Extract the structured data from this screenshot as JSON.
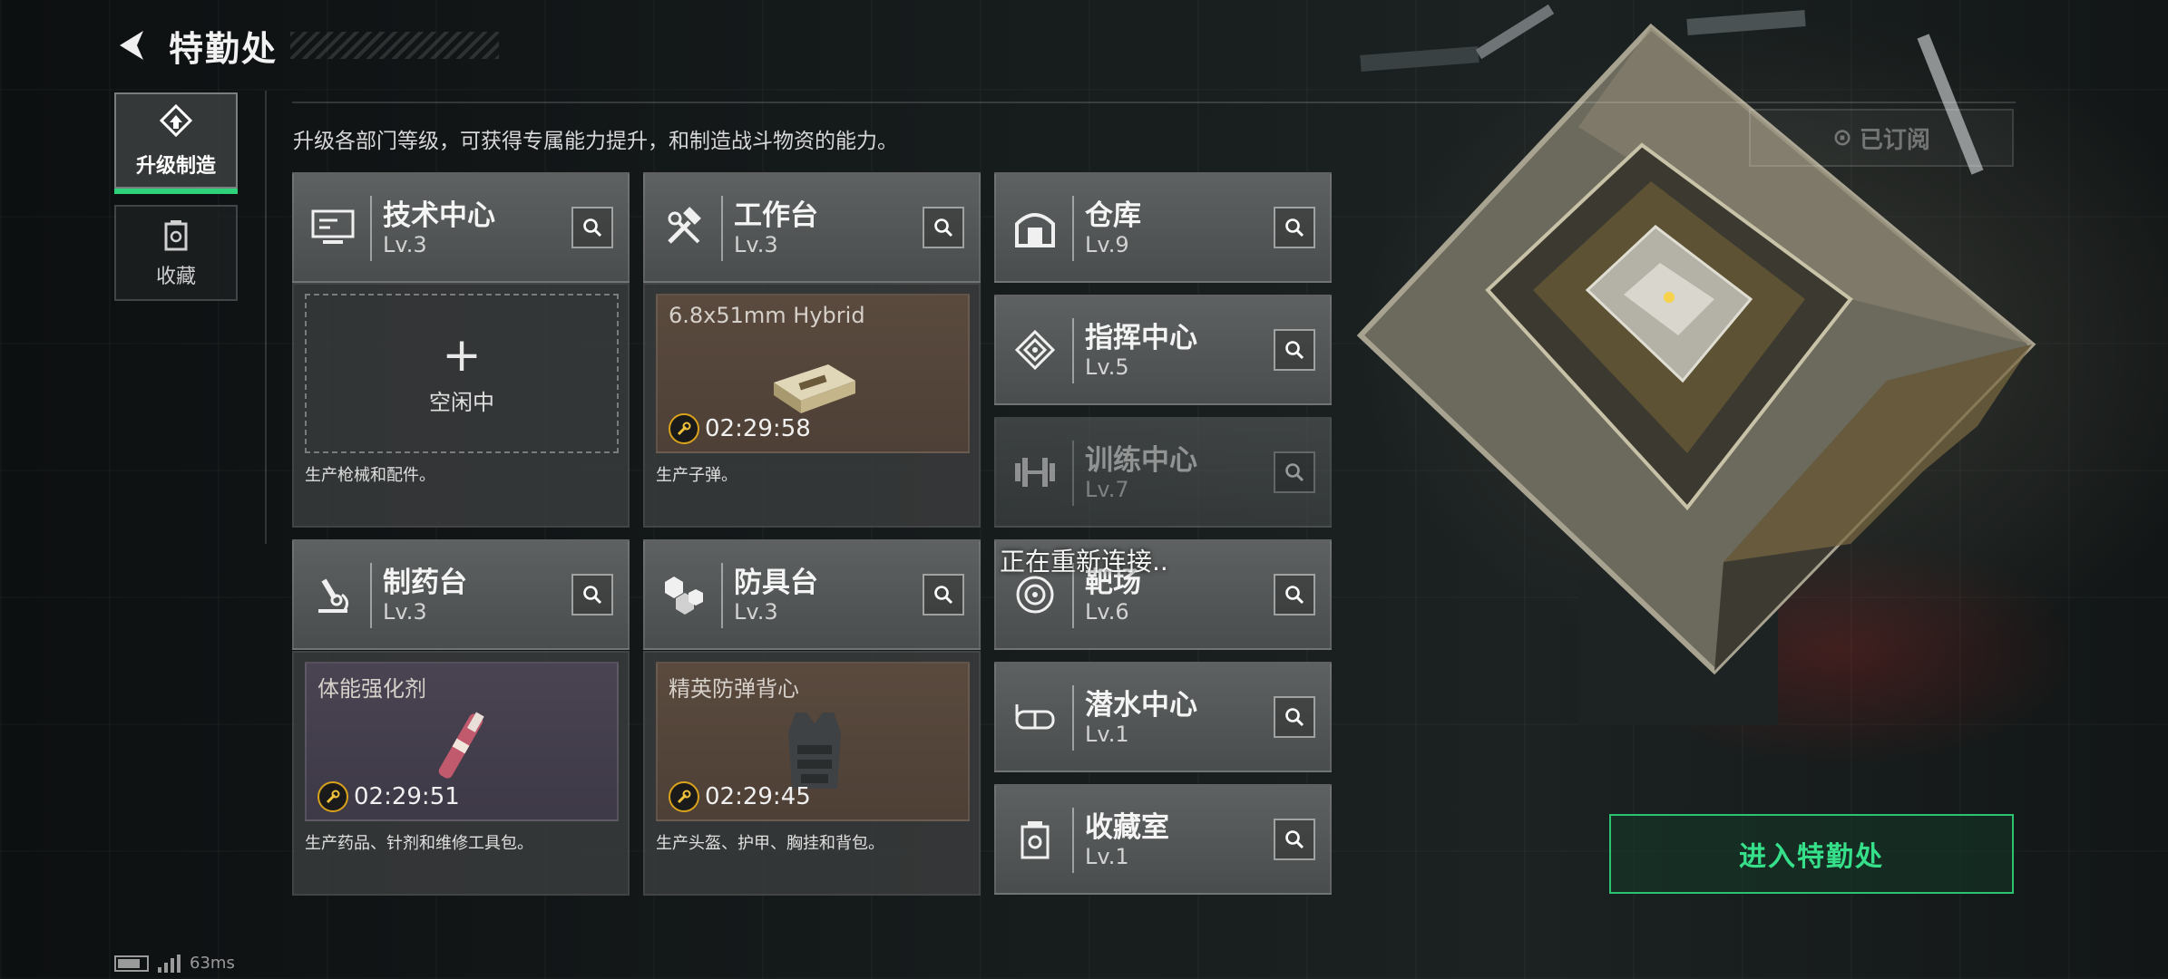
{
  "header": {
    "title": "特勤处"
  },
  "side_tabs": [
    {
      "label": "升级制造",
      "active": true
    },
    {
      "label": "收藏",
      "active": false
    }
  ],
  "description": "升级各部门等级，可获得专属能力提升，和制造战斗物资的能力。",
  "subscribed_label": "已订阅",
  "departments": [
    {
      "name": "技术中心",
      "level": "Lv.3",
      "icon": "computer-icon"
    },
    {
      "name": "工作台",
      "level": "Lv.3",
      "icon": "hammer-wrench-icon"
    },
    {
      "name": "仓库",
      "level": "Lv.9",
      "icon": "warehouse-icon"
    },
    {
      "name": "指挥中心",
      "level": "Lv.5",
      "icon": "command-chip-icon"
    },
    {
      "name": "训练中心",
      "level": "Lv.7",
      "icon": "dumbbell-icon"
    },
    {
      "name": "制药台",
      "level": "Lv.3",
      "icon": "microscope-icon"
    },
    {
      "name": "防具台",
      "level": "Lv.3",
      "icon": "armor-blocks-icon"
    },
    {
      "name": "靶场",
      "level": "Lv.6",
      "icon": "target-icon"
    },
    {
      "name": "潜水中心",
      "level": "Lv.1",
      "icon": "diving-mask-icon"
    },
    {
      "name": "收藏室",
      "level": "Lv.1",
      "icon": "collection-icon"
    }
  ],
  "production": {
    "tech_center": {
      "status": "空闲中",
      "description": "生产枪械和配件。"
    },
    "workbench": {
      "item": "6.8x51mm Hybrid",
      "timer": "02:29:58",
      "description": "生产子弹。"
    },
    "pharmacy": {
      "item": "体能强化剂",
      "timer": "02:29:51",
      "description": "生产药品、针剂和维修工具包。"
    },
    "armor": {
      "item": "精英防弹背心",
      "timer": "02:29:45",
      "description": "生产头盔、护甲、胸挂和背包。"
    }
  },
  "reconnect_text": "正在重新连接..",
  "enter_button": "进入特勤处",
  "status_bar": {
    "latency": "63ms"
  },
  "colors": {
    "accent_green": "#2ed27a",
    "timer_ring": "#d9a21b"
  }
}
